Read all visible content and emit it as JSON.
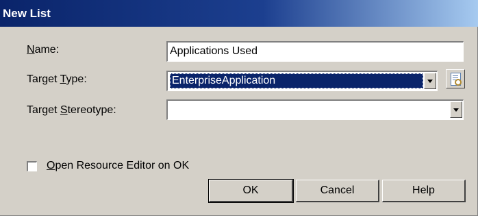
{
  "window": {
    "title": "New List"
  },
  "fields": {
    "name": {
      "label_mnemonic": "N",
      "label_rest": "ame:",
      "value": "Applications Used"
    },
    "target_type": {
      "label_before": "Target ",
      "label_mnemonic": "T",
      "label_rest": "ype:",
      "value": "EnterpriseApplication"
    },
    "target_stereotype": {
      "label_before": "Target ",
      "label_mnemonic": "S",
      "label_rest": "tereotype:",
      "value": ""
    }
  },
  "checkbox": {
    "mnemonic": "O",
    "label_rest": "pen Resource Editor on OK",
    "checked": false
  },
  "buttons": {
    "ok": "OK",
    "cancel": "Cancel",
    "help": "Help"
  },
  "icons": {
    "dropdown": "chevron-down-icon",
    "properties": "properties-icon"
  }
}
